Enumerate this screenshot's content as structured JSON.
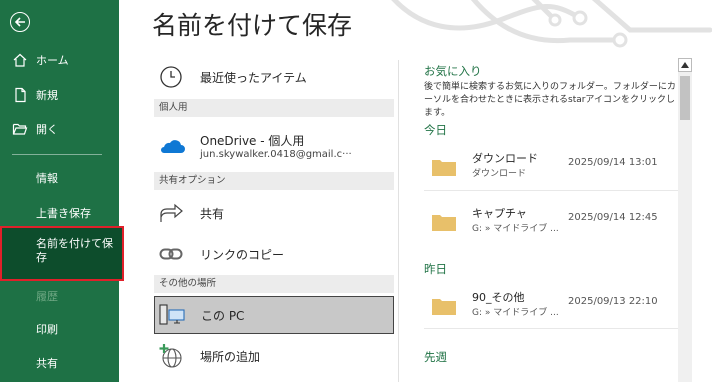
{
  "sidebar": {
    "items": [
      {
        "label": "ホーム",
        "icon": "home-icon"
      },
      {
        "label": "新規",
        "icon": "new-document-icon"
      },
      {
        "label": "開く",
        "icon": "folder-open-icon"
      }
    ],
    "info": "情報",
    "overwrite_save": "上書き保存",
    "save_as": "名前を付けて保存",
    "history": "履歴",
    "print": "印刷",
    "share": "共有"
  },
  "page": {
    "title": "名前を付けて保存"
  },
  "locations": {
    "recent": "最近使ったアイテム",
    "personal_header": "個人用",
    "onedrive_name": "OneDrive - 個人用",
    "onedrive_account": "jun.skywalker.0418@gmail.c···",
    "shared_header": "共有オプション",
    "share": "共有",
    "copy_link": "リンクのコピー",
    "other_header": "その他の場所",
    "this_pc": "この PC",
    "add_place": "場所の追加"
  },
  "recent": {
    "favorites_title": "お気に入り",
    "favorites_desc": "後で簡単に検索するお気に入りのフォルダー。フォルダーにカーソルを合わせたときに表示されるstarアイコンをクリックします。",
    "today_title": "今日",
    "yesterday_title": "昨日",
    "last_week_title": "先週",
    "today": [
      {
        "name": "ダウンロード",
        "path": "ダウンロード",
        "date": "2025/09/14 13:01"
      },
      {
        "name": "キャプチャ",
        "path": "G: » マイドライブ ...",
        "date": "2025/09/14 12:45"
      }
    ],
    "yesterday": [
      {
        "name": "90_その他",
        "path": "G: » マイドライブ ...",
        "date": "2025/09/13 22:10"
      }
    ]
  },
  "colors": {
    "sidebar": "#1e7145",
    "selected": "#0d4d2c",
    "highlight_border": "#e0202a",
    "accent": "#217346",
    "folder": "#e8c06a"
  }
}
